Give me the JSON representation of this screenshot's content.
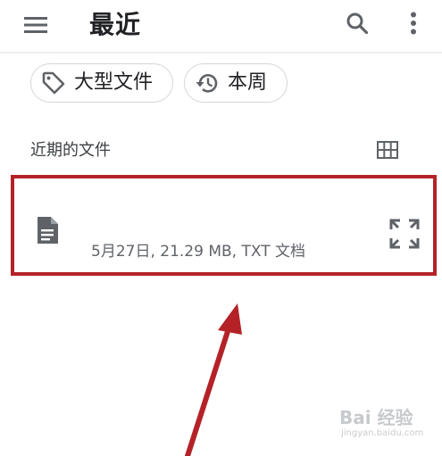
{
  "appbar": {
    "title": "最近",
    "icons": {
      "menu": "hamburger-menu-icon",
      "search": "search-icon",
      "more": "more-vert-icon"
    }
  },
  "chips": [
    {
      "label": "大型文件",
      "icon": "tag-icon"
    },
    {
      "label": "本周",
      "icon": "history-icon"
    }
  ],
  "section": {
    "title": "近期的文件",
    "view_icon": "grid-view-icon"
  },
  "file": {
    "meta": "5月27日, 21.29 MB, TXT 文档",
    "icon": "document-icon",
    "action_icon": "expand-icon",
    "highlight_color": "#b42228"
  },
  "watermark": {
    "main": "Bai 经验",
    "sub": "jingyan.baidu.com"
  }
}
